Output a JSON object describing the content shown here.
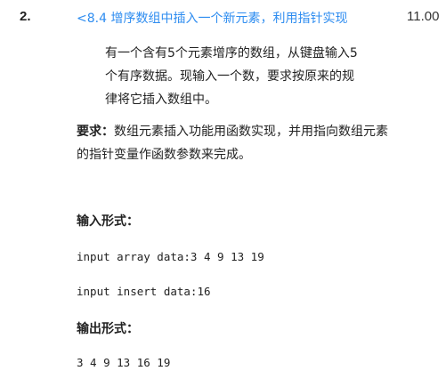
{
  "question": {
    "number": "2.",
    "title": "<8.4 增序数组中插入一个新元素，利用指针实现",
    "score": "11.00"
  },
  "description": {
    "line1": "有一个含有5个元素增序的数组，从键盘输入5",
    "line2": "个有序数据。现输入一个数，要求按原来的规",
    "line3": "律将它插入数组中。"
  },
  "requirement": {
    "label": "要求：",
    "text": "数组元素插入功能用函数实现，并用指向数组元素的指针变量作函数参数来完成。"
  },
  "input_format": {
    "heading": "输入形式：",
    "line1": "input array data:3 4 9 13 19",
    "line2": "input insert data:16"
  },
  "output_format": {
    "heading": "输出形式：",
    "line1": "3 4 9 13 16 19"
  }
}
